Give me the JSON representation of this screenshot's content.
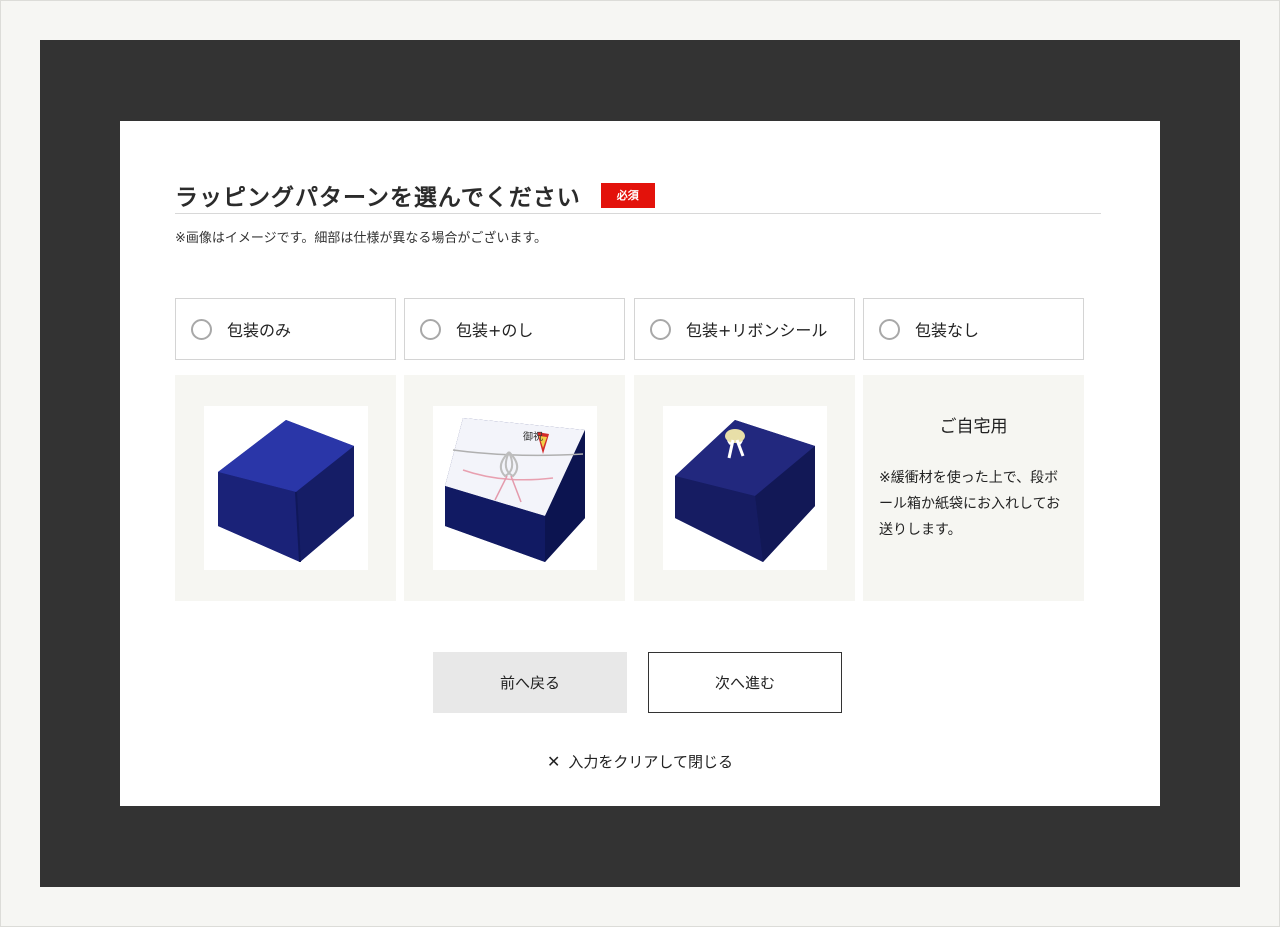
{
  "modal": {
    "title": "ラッピングパターンを選んでください",
    "required_badge": "必須",
    "note": "※画像はイメージです。細部は仕様が異なる場合がございます。"
  },
  "options": [
    {
      "label": "包装のみ",
      "selected": false
    },
    {
      "label": "包装+のし",
      "selected": false
    },
    {
      "label": "包装+リボンシール",
      "selected": false
    },
    {
      "label": "包装なし",
      "selected": false
    }
  ],
  "home_card": {
    "title": "ご自宅用",
    "description": "※緩衝材を使った上で、段ボール箱か紙袋にお入れしてお送りします。"
  },
  "noshi_text": "御祝",
  "buttons": {
    "back": "前へ戻る",
    "next": "次へ進む"
  },
  "clear_link": "入力をクリアして閉じる",
  "colors": {
    "overlay": "#333333",
    "required": "#e3120b",
    "wrap_navy": "#1f2a8a"
  }
}
